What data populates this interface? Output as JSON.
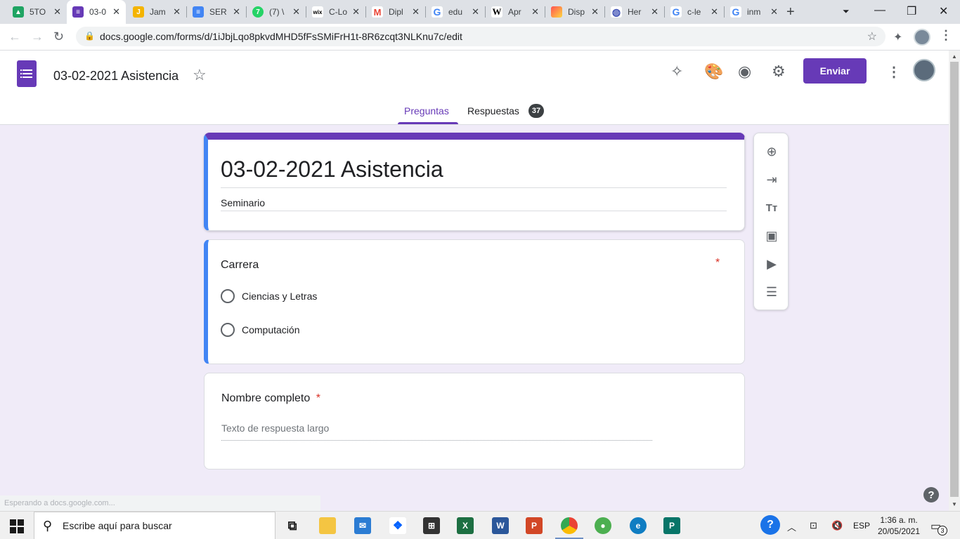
{
  "browser": {
    "tabs": [
      {
        "label": "5TO",
        "icon": "google-drive-icon",
        "color": "#1fa463"
      },
      {
        "label": "03-0",
        "icon": "google-forms-icon",
        "color": "#673ab7"
      },
      {
        "label": "Jam",
        "icon": "jamboard-icon",
        "color": "#f4b400"
      },
      {
        "label": "SER",
        "icon": "google-docs-icon",
        "color": "#4285f4"
      },
      {
        "label": "(7) \\",
        "icon": "whatsapp-icon",
        "color": "#25d366"
      },
      {
        "label": "C-Lo",
        "icon": "wix-icon",
        "color": "#000000"
      },
      {
        "label": "Dipl",
        "icon": "gmail-icon",
        "color": "#ea4335"
      },
      {
        "label": "edu",
        "icon": "google-icon",
        "color": "#4285f4"
      },
      {
        "label": "Apr",
        "icon": "wikipedia-icon",
        "color": "#000000"
      },
      {
        "label": "Disp",
        "icon": "image-icon",
        "color": "#ff7043"
      },
      {
        "label": "Her",
        "icon": "globe-icon",
        "color": "#3f51b5"
      },
      {
        "label": "c-le",
        "icon": "google-icon",
        "color": "#4285f4"
      },
      {
        "label": "inm",
        "icon": "google-icon",
        "color": "#4285f4"
      }
    ],
    "url": "docs.google.com/forms/d/1iJbjLqo8pkvdMHD5fFsSMiFrH1t-8R6zcqt3NLKnu7c/edit"
  },
  "header": {
    "doc_title": "03-02-2021 Asistencia",
    "send_label": "Enviar",
    "tabs": [
      {
        "label": "Preguntas"
      },
      {
        "label": "Respuestas",
        "badge": "37"
      }
    ]
  },
  "form": {
    "title": "03-02-2021 Asistencia",
    "description": "Seminario",
    "questions": [
      {
        "title": "Carrera",
        "required_mark": "*",
        "options": [
          "Ciencias y Letras",
          "Computación"
        ]
      },
      {
        "title": "Nombre completo",
        "required_mark": "*",
        "placeholder": "Texto de respuesta largo"
      }
    ]
  },
  "sidebar_tools": [
    "add-question-icon",
    "import-questions-icon",
    "add-title-icon",
    "add-image-icon",
    "add-video-icon",
    "add-section-icon"
  ],
  "status_text": "Esperando a docs.google.com...",
  "taskbar": {
    "search_placeholder": "Escribe aquí para buscar",
    "language": "ESP",
    "time": "1:36 a. m.",
    "date": "20/05/2021",
    "notification_count": "3"
  },
  "colors": {
    "accent": "#673ab7",
    "focus_blue": "#4285f4",
    "required_red": "#d93025",
    "background": "#f0ebf8"
  }
}
